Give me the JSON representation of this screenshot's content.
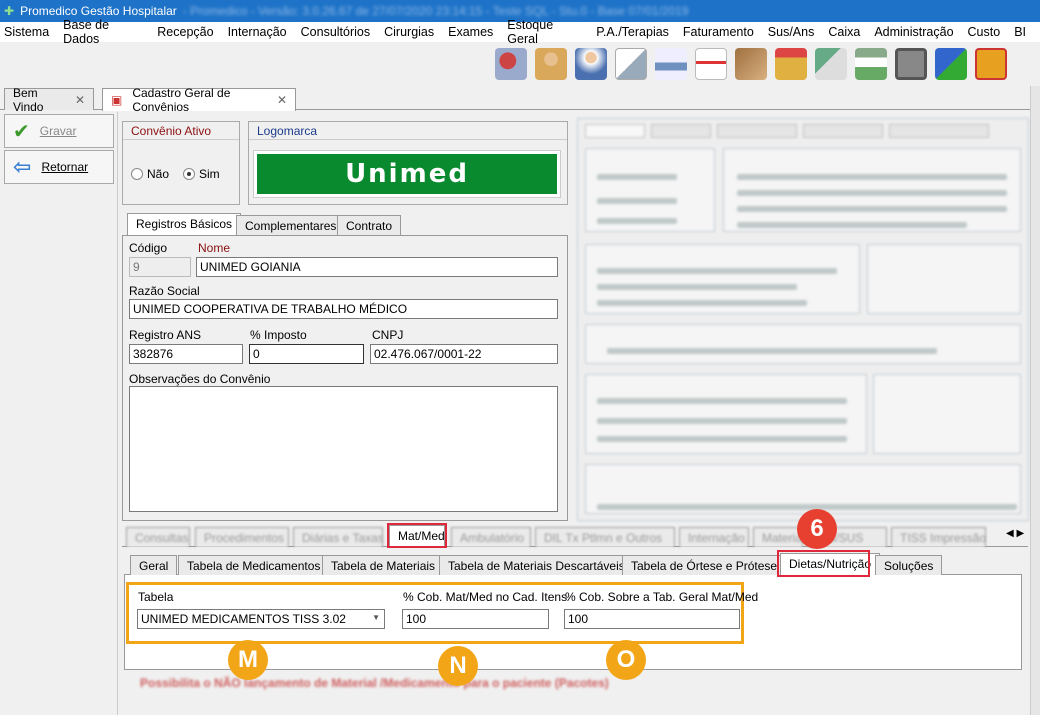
{
  "window": {
    "title": "Promedico Gestão Hospitalar",
    "title_blurred": "- Promedico - Versão: 3.0.26.67 de 27/07/2020 23:14:15 - Teste SQL - Stu.0 - Base 07/01/2019"
  },
  "menu": [
    "Sistema",
    "Base de Dados",
    "Recepção",
    "Internação",
    "Consultórios",
    "Cirurgias",
    "Exames",
    "Estoque Geral",
    "P.A./Terapias",
    "Faturamento",
    "Sus/Ans",
    "Caixa",
    "Administração",
    "Custo",
    "BI"
  ],
  "toolbar_icons": [
    "agenda-icon",
    "patients-icon",
    "doctor-icon",
    "documents-icon",
    "bed-icon",
    "ambulance-icon",
    "stock-icon",
    "finance-icon",
    "money-icon",
    "cash-icon",
    "safe-icon",
    "card-payment-icon",
    "phone-icon"
  ],
  "doctabs": [
    {
      "label": "Bem Vindo"
    },
    {
      "label": "Cadastro Geral de Convênios"
    }
  ],
  "left": {
    "save": "Gravar",
    "back": "Retornar"
  },
  "convenio_ativo": {
    "title": "Convênio Ativo",
    "no": "Não",
    "yes": "Sim",
    "selected": "Sim"
  },
  "logo": {
    "title": "Logomarca",
    "text": "Unimed"
  },
  "inner_tabs": [
    "Registros Básicos",
    "Complementares",
    "Contrato"
  ],
  "form": {
    "codigo_label": "Código",
    "codigo": "9",
    "nome_label": "Nome",
    "nome": "UNIMED GOIANIA",
    "razao_label": "Razão Social",
    "razao": "UNIMED COOPERATIVA DE TRABALHO MÉDICO",
    "ans_label": "Registro ANS",
    "ans": "382876",
    "imposto_label": "% Imposto",
    "imposto": "0",
    "cnpj_label": "CNPJ",
    "cnpj": "02.476.067/0001-22",
    "obs_label": "Observações do Convênio"
  },
  "bottom_tabs": {
    "active": "Mat/Med",
    "blurred": [
      "Consultas",
      "Procedimentos",
      "Diárias e Taxas",
      "Ambulatório",
      "DIL Tx Ptlmn e Outros",
      "Internação",
      "Materiais",
      "SIS/SUS",
      "TISS Impressão"
    ]
  },
  "sub_tabs": [
    "Geral",
    "Tabela de Medicamentos",
    "Tabela de Materiais",
    "Tabela de Materiais Descartáveis",
    "Tabela de Órtese e Prótese",
    "Dietas/Nutrição",
    "Soluções"
  ],
  "dietas": {
    "tabela_label": "Tabela",
    "tabela": "UNIMED MEDICAMENTOS TISS 3.02",
    "cob_label": "% Cob. Mat/Med no Cad. Itens",
    "cob": "100",
    "cob_geral_label": "% Cob. Sobre a Tab. Geral Mat/Med",
    "cob_geral": "100"
  },
  "blurred_checkbox": "Possibilita o NÃO lançamento de Material /Medicamento para o paciente (Pacotes)",
  "badges": {
    "six": "6",
    "m": "M",
    "n": "N",
    "o": "O"
  }
}
